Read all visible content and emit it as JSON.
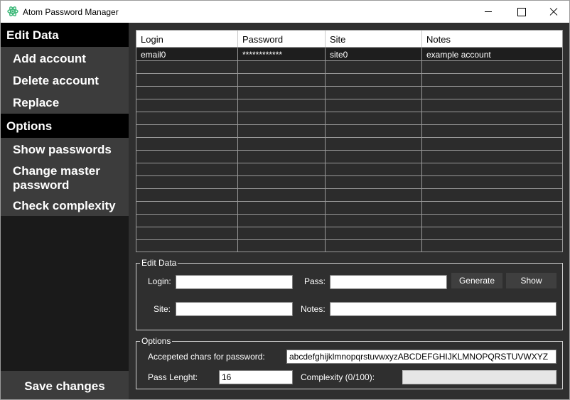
{
  "window": {
    "title": "Atom Password Manager",
    "icon": "atom-icon"
  },
  "sidebar": {
    "edit_header": "Edit Data",
    "edit_items": [
      {
        "label": "Add account"
      },
      {
        "label": "Delete account"
      },
      {
        "label": "Replace"
      }
    ],
    "options_header": "Options",
    "options_items": [
      {
        "label": "Show passwords"
      },
      {
        "label": "Change master password"
      },
      {
        "label": "Check complexity"
      }
    ],
    "save_label": "Save changes"
  },
  "grid": {
    "columns": [
      "Login",
      "Password",
      "Site",
      "Notes"
    ],
    "rows": [
      [
        "email0",
        "************",
        "site0",
        "example account"
      ],
      [
        "",
        "",
        "",
        ""
      ],
      [
        "",
        "",
        "",
        ""
      ],
      [
        "",
        "",
        "",
        ""
      ],
      [
        "",
        "",
        "",
        ""
      ],
      [
        "",
        "",
        "",
        ""
      ],
      [
        "",
        "",
        "",
        ""
      ],
      [
        "",
        "",
        "",
        ""
      ],
      [
        "",
        "",
        "",
        ""
      ],
      [
        "",
        "",
        "",
        ""
      ],
      [
        "",
        "",
        "",
        ""
      ],
      [
        "",
        "",
        "",
        ""
      ],
      [
        "",
        "",
        "",
        ""
      ],
      [
        "",
        "",
        "",
        ""
      ],
      [
        "",
        "",
        "",
        ""
      ],
      [
        "",
        "",
        "",
        ""
      ]
    ]
  },
  "edit_group": {
    "legend": "Edit Data",
    "login_label": "Login:",
    "login_value": "",
    "pass_label": "Pass:",
    "pass_value": "",
    "generate_label": "Generate",
    "show_label": "Show",
    "site_label": "Site:",
    "site_value": "",
    "notes_label": "Notes:",
    "notes_value": ""
  },
  "options_group": {
    "legend": "Options",
    "chars_label": "Accepeted chars for password:",
    "chars_value": "abcdefghijklmnopqrstuvwxyzABCDEFGHIJKLMNOPQRSTUVWXYZ",
    "length_label": "Pass Lenght:",
    "length_value": "16",
    "complexity_label": "Complexity (0/100):",
    "complexity_value": 0
  },
  "colors": {
    "sidebar_bg": "#1a1a1a",
    "sidebar_header_bg": "#000000",
    "sidebar_item_bg": "#3c3c3c",
    "main_bg": "#2f2f2f",
    "accent_icon": "#3cb878"
  }
}
